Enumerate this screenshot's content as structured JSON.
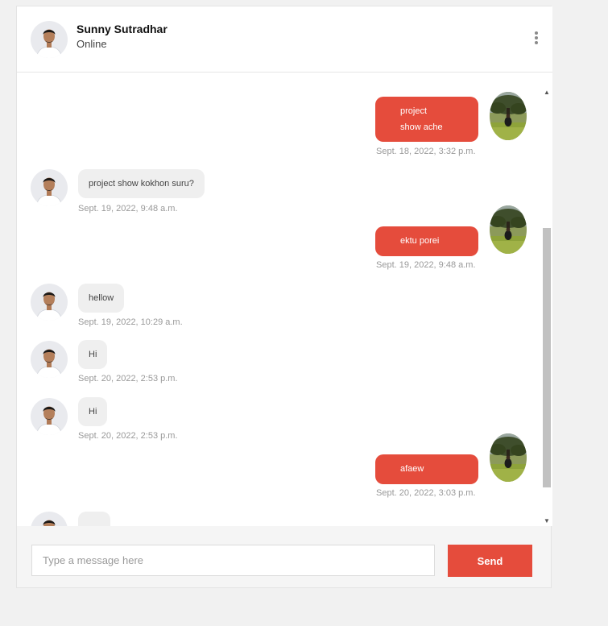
{
  "header": {
    "name": "Sunny Sutradhar",
    "status": "Online",
    "menu_icon": "kebab-menu-icon"
  },
  "messages": [
    {
      "direction": "out",
      "text_lines": [
        "project",
        "show ache"
      ],
      "time": "Sept. 18, 2022, 3:32 p.m."
    },
    {
      "direction": "in",
      "text": "project show kokhon suru?",
      "time": "Sept. 19, 2022, 9:48 a.m."
    },
    {
      "direction": "out",
      "text": "ektu porei",
      "time": "Sept. 19, 2022, 9:48 a.m."
    },
    {
      "direction": "in",
      "text": "hellow",
      "time": "Sept. 19, 2022, 10:29 a.m."
    },
    {
      "direction": "in",
      "text": "Hi",
      "time": "Sept. 20, 2022, 2:53 p.m."
    },
    {
      "direction": "in",
      "text": "Hi",
      "time": "Sept. 20, 2022, 2:53 p.m."
    },
    {
      "direction": "out",
      "text": "afaew",
      "time": "Sept. 20, 2022, 3:03 p.m."
    }
  ],
  "composer": {
    "placeholder": "Type a message here",
    "value": "",
    "send_label": "Send"
  },
  "colors": {
    "accent": "#e54c3c",
    "incoming_bubble": "#efefef",
    "timestamp": "#999999"
  }
}
